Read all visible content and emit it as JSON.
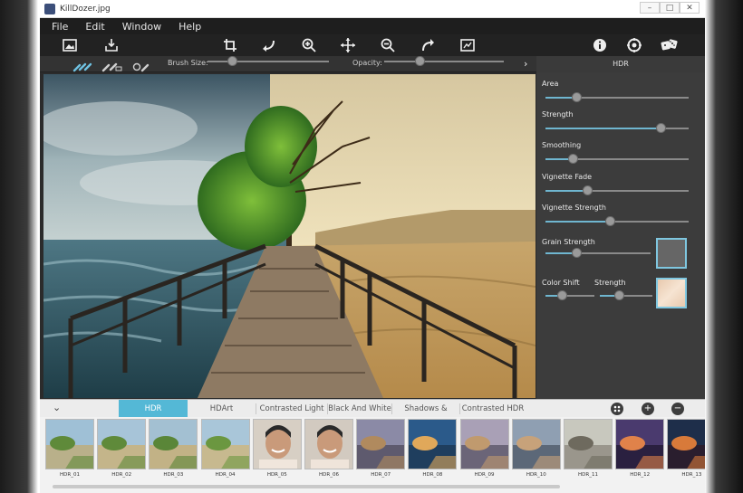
{
  "window": {
    "title": "KillDozer.jpg",
    "controls": [
      "–",
      "□",
      "✕"
    ]
  },
  "menu": [
    "File",
    "Edit",
    "Window",
    "Help"
  ],
  "toolbar": {
    "icons_left": [
      "open-image-icon",
      "save-icon"
    ],
    "icons_center": [
      "crop-icon",
      "undo-icon",
      "zoom-in-icon",
      "move-icon",
      "zoom-out-icon",
      "redo-icon",
      "fit-image-icon"
    ],
    "icons_right": [
      "info-icon",
      "settings-icon",
      "random-dice-icon"
    ]
  },
  "subbar": {
    "brush_size_label": "Brush Size:",
    "brush_size_value": 0.18,
    "opacity_label": "Opacity:",
    "opacity_value": 0.28,
    "panel_title": "HDR"
  },
  "panel": {
    "sliders": [
      {
        "label": "Area",
        "value": 0.2
      },
      {
        "label": "Strength",
        "value": 0.83
      },
      {
        "label": "Smoothing",
        "value": 0.17
      },
      {
        "label": "Vignette Fade",
        "value": 0.28
      },
      {
        "label": "Vignette Strength",
        "value": 0.45
      }
    ],
    "grain_label": "Grain Strength",
    "grain_value": 0.28,
    "color_shift_label": "Color Shift",
    "color_shift_value": 0.3,
    "color_strength_label": "Strength",
    "color_strength_value": 0.35,
    "grain_swatch_color": "#666666",
    "color_swatch_color": "#e8c9ae"
  },
  "tabs": {
    "items": [
      "HDR",
      "HDArt",
      "Contrasted Light",
      "Black And White",
      "Shadows & Lights",
      "Contrasted HDR"
    ],
    "active": "HDR",
    "buttons": [
      "palette-icon",
      "add-icon",
      "remove-icon"
    ]
  },
  "filmstrip": {
    "thumbs": [
      "HDR_01",
      "HDR_02",
      "HDR_03",
      "HDR_04",
      "HDR_05",
      "HDR_06",
      "HDR_07",
      "HDR_08",
      "HDR_09",
      "HDR_10",
      "HDR_11",
      "HDR_12",
      "HDR_13"
    ]
  },
  "colors": {
    "accent": "#54b8d6",
    "slider_fill": "#6fb6d0"
  }
}
